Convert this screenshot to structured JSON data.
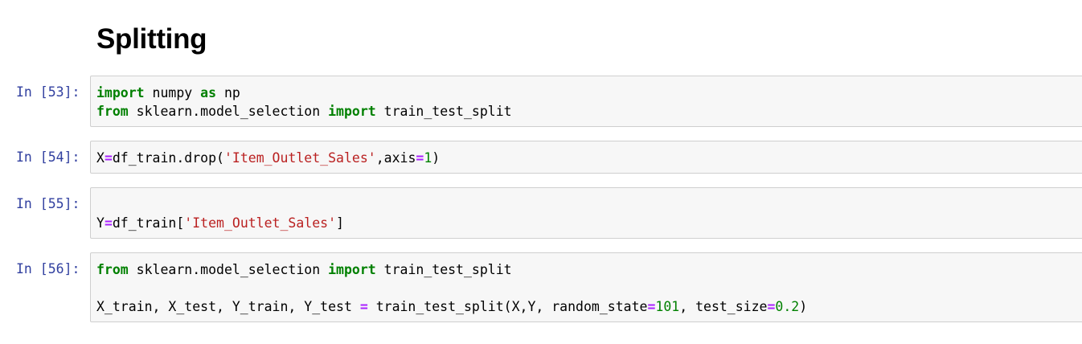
{
  "heading": "Splitting",
  "cells": [
    {
      "prompt": "In [53]:",
      "lines": [
        [
          [
            "kw",
            "import"
          ],
          [
            "plain",
            " numpy "
          ],
          [
            "kw",
            "as"
          ],
          [
            "plain",
            " np"
          ]
        ],
        [
          [
            "kw",
            "from"
          ],
          [
            "plain",
            " sklearn.model_selection "
          ],
          [
            "kw",
            "import"
          ],
          [
            "plain",
            " train_test_split"
          ]
        ]
      ]
    },
    {
      "prompt": "In [54]:",
      "lines": [
        [
          [
            "plain",
            "X"
          ],
          [
            "op",
            "="
          ],
          [
            "plain",
            "df_train.drop("
          ],
          [
            "str",
            "'Item_Outlet_Sales'"
          ],
          [
            "plain",
            ",axis"
          ],
          [
            "op",
            "="
          ],
          [
            "num",
            "1"
          ],
          [
            "plain",
            ")"
          ]
        ]
      ]
    },
    {
      "prompt": "In [55]:",
      "lines": [
        [],
        [
          [
            "plain",
            "Y"
          ],
          [
            "op",
            "="
          ],
          [
            "plain",
            "df_train["
          ],
          [
            "str",
            "'Item_Outlet_Sales'"
          ],
          [
            "plain",
            "]"
          ]
        ]
      ]
    },
    {
      "prompt": "In [56]:",
      "lines": [
        [
          [
            "kw",
            "from"
          ],
          [
            "plain",
            " sklearn.model_selection "
          ],
          [
            "kw",
            "import"
          ],
          [
            "plain",
            " train_test_split"
          ]
        ],
        [],
        [
          [
            "plain",
            "X_train, X_test, Y_train, Y_test "
          ],
          [
            "op",
            "="
          ],
          [
            "plain",
            " train_test_split(X,Y, random_state"
          ],
          [
            "op",
            "="
          ],
          [
            "num",
            "101"
          ],
          [
            "plain",
            ", test_size"
          ],
          [
            "op",
            "="
          ],
          [
            "num",
            "0.2"
          ],
          [
            "plain",
            ")"
          ]
        ]
      ]
    }
  ]
}
